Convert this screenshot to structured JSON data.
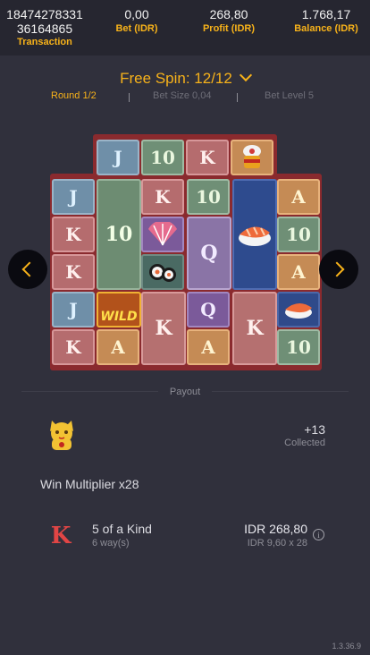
{
  "header": {
    "transaction_line1": "18474278331",
    "transaction_line2": "36164865",
    "transaction_label": "Transaction",
    "bet_value": "0,00",
    "bet_label": "Bet (IDR)",
    "profit_value": "268,80",
    "profit_label": "Profit (IDR)",
    "balance_value": "1.768,17",
    "balance_label": "Balance (IDR)"
  },
  "free_spin": {
    "title": "Free Spin: 12/12"
  },
  "info_row": {
    "round": "Round 1/2",
    "bet_size": "Bet Size 0,04",
    "bet_level": "Bet Level 5"
  },
  "board": {
    "top_row": [
      "J",
      "10",
      "K",
      "lantern"
    ],
    "columns": [
      [
        "J",
        "K",
        "K",
        "J",
        "K"
      ],
      [
        "10",
        "10",
        "10",
        "WILD",
        "A"
      ],
      [
        "K",
        "fan",
        "sushi-roll",
        "K",
        "K"
      ],
      [
        "10",
        "Q",
        "Q",
        "Q",
        "A"
      ],
      [
        "salmon-nigiri",
        "salmon-nigiri",
        "salmon-nigiri",
        "K",
        "K"
      ],
      [
        "A",
        "10",
        "A",
        "salmon-nigiri",
        "10"
      ]
    ],
    "wild_label": "WILD"
  },
  "payout": {
    "section_label": "Payout",
    "collected_value": "+13",
    "collected_label": "Collected",
    "multiplier_text": "Win Multiplier x28",
    "symbol": "K",
    "kind_text": "5 of a Kind",
    "ways_text": "6 way(s)",
    "amount_text": "IDR 268,80",
    "calc_text": "IDR 9,60 x 28",
    "info_glyph": "i"
  },
  "version": "1.3.36.9",
  "colors": {
    "accent": "#f7b21a",
    "background": "#30303c",
    "reel_frame": "#8a2a2e"
  }
}
